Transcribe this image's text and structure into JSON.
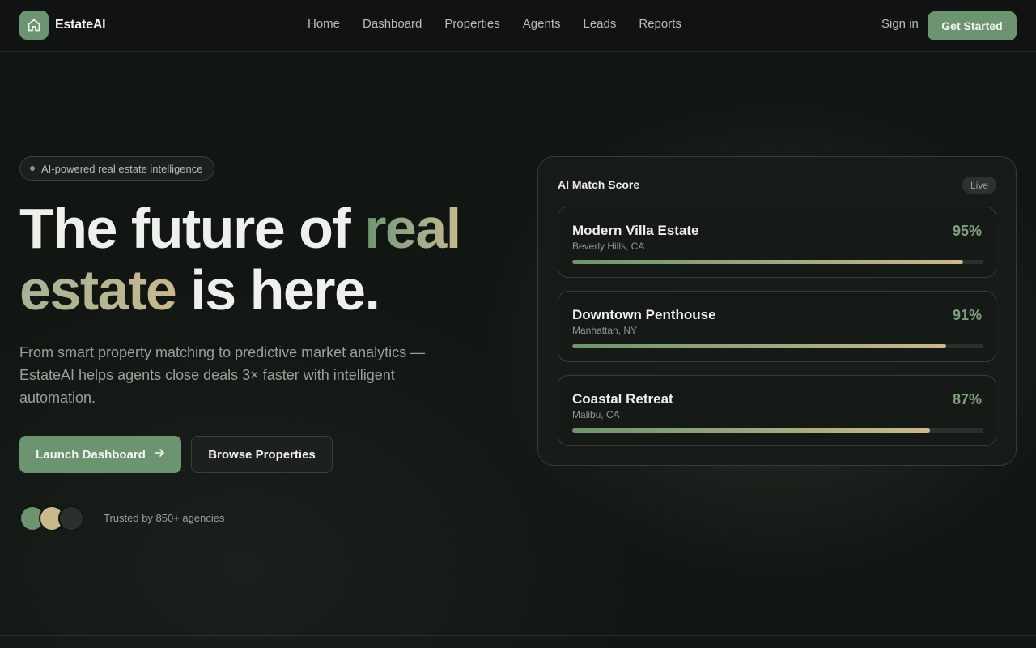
{
  "brand": {
    "name": "EstateAI",
    "accent": "#6d9470",
    "gold": "#c9b98c"
  },
  "nav": {
    "links": [
      "Home",
      "Dashboard",
      "Properties",
      "Agents",
      "Leads",
      "Reports"
    ],
    "signin": "Sign in",
    "cta": "Get Started"
  },
  "hero": {
    "badge": "AI-powered real estate intelligence",
    "headline": {
      "part1": "The future of ",
      "highlight1": "real",
      "highlight2": "estate",
      "part2": " is here."
    },
    "subtitle": "From smart property matching to predictive market analytics — EstateAI helps agents close deals 3× faster with intelligent automation.",
    "primary_button": "Launch Dashboard",
    "secondary_button": "Browse Properties",
    "avatar_colors": [
      "#6d9470",
      "#c9b98c",
      "#2a302b"
    ],
    "trusted": "Trusted by 850+ agencies"
  },
  "card": {
    "title": "AI Match Score",
    "status": "Live",
    "matches": [
      {
        "name": "Modern Villa Estate",
        "location": "Beverly Hills, CA",
        "score": "95%",
        "value": 95
      },
      {
        "name": "Downtown Penthouse",
        "location": "Manhattan, NY",
        "score": "91%",
        "value": 91
      },
      {
        "name": "Coastal Retreat",
        "location": "Malibu, CA",
        "score": "87%",
        "value": 87
      }
    ]
  }
}
